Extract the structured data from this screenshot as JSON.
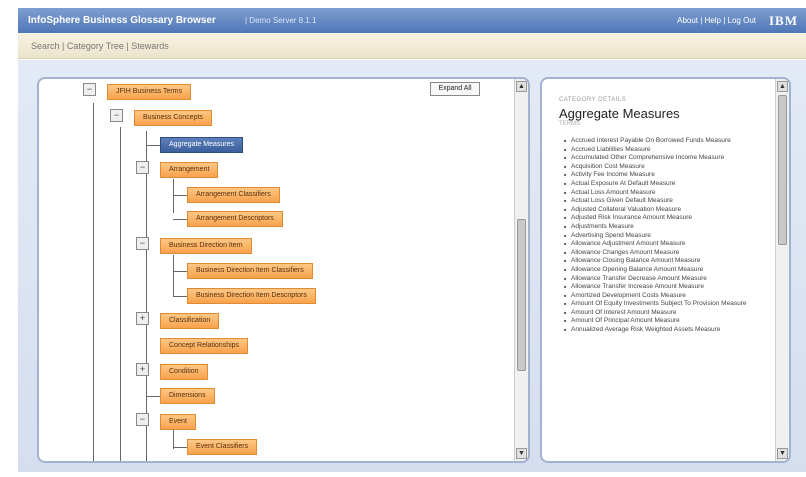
{
  "app": {
    "title": "InfoSphere Business Glossary Browser",
    "subtitle": "| Demo Server 8.1.1",
    "links": [
      "About",
      "Help",
      "Log Out"
    ],
    "logo": "IBM"
  },
  "nav": {
    "items": [
      "Search",
      "Category Tree",
      "Stewards"
    ]
  },
  "tree": {
    "expand_all_label": "Expand All",
    "nodes": [
      "JFIH Business Terms",
      "Business Concepts",
      "Aggregate Measures",
      "Arrangement",
      "Arrangement Classifiers",
      "Arrangement Descriptors",
      "Business Direction Item",
      "Business Direction Item Classifiers",
      "Business Direction Item Descriptors",
      "Classification",
      "Concept Relationships",
      "Condition",
      "Dimensions",
      "Event",
      "Event Classifiers"
    ],
    "toggles": [
      "−",
      "−",
      "−",
      "−",
      "+",
      "+",
      "−"
    ]
  },
  "details": {
    "section_label": "CATEGORY DETAILS",
    "title": "Aggregate Measures",
    "sub_label": "TERMS",
    "terms": [
      "Accrued Interest Payable On Borrowed Funds Measure",
      "Accrued Liabilities Measure",
      "Accumulated Other Comprehensive Income Measure",
      "Acquisition Cost Measure",
      "Activity Fee Income Measure",
      "Actual Exposure At Default Measure",
      "Actual Loss Amount Measure",
      "Actual Loss Given Default Measure",
      "Adjusted Collateral Valuation Measure",
      "Adjusted Risk Insurance Amount Measure",
      "Adjustments Measure",
      "Advertising Spend Measure",
      "Allowance Adjustment Amount Measure",
      "Allowance Changes Amount Measure",
      "Allowance Closing Balance Amount Measure",
      "Allowance Opening Balance Amount Measure",
      "Allowance Transfer Decrease Amount Measure",
      "Allowance Transfer Increase Amount Measure",
      "Amortized Development Costs Measure",
      "Amount Of Equity Investments Subject To Provision Measure",
      "Amount Of Interest Amount Measure",
      "Amount Of Principal Amount Measure",
      "Annualized Average Risk Weighted Assets Measure"
    ]
  }
}
